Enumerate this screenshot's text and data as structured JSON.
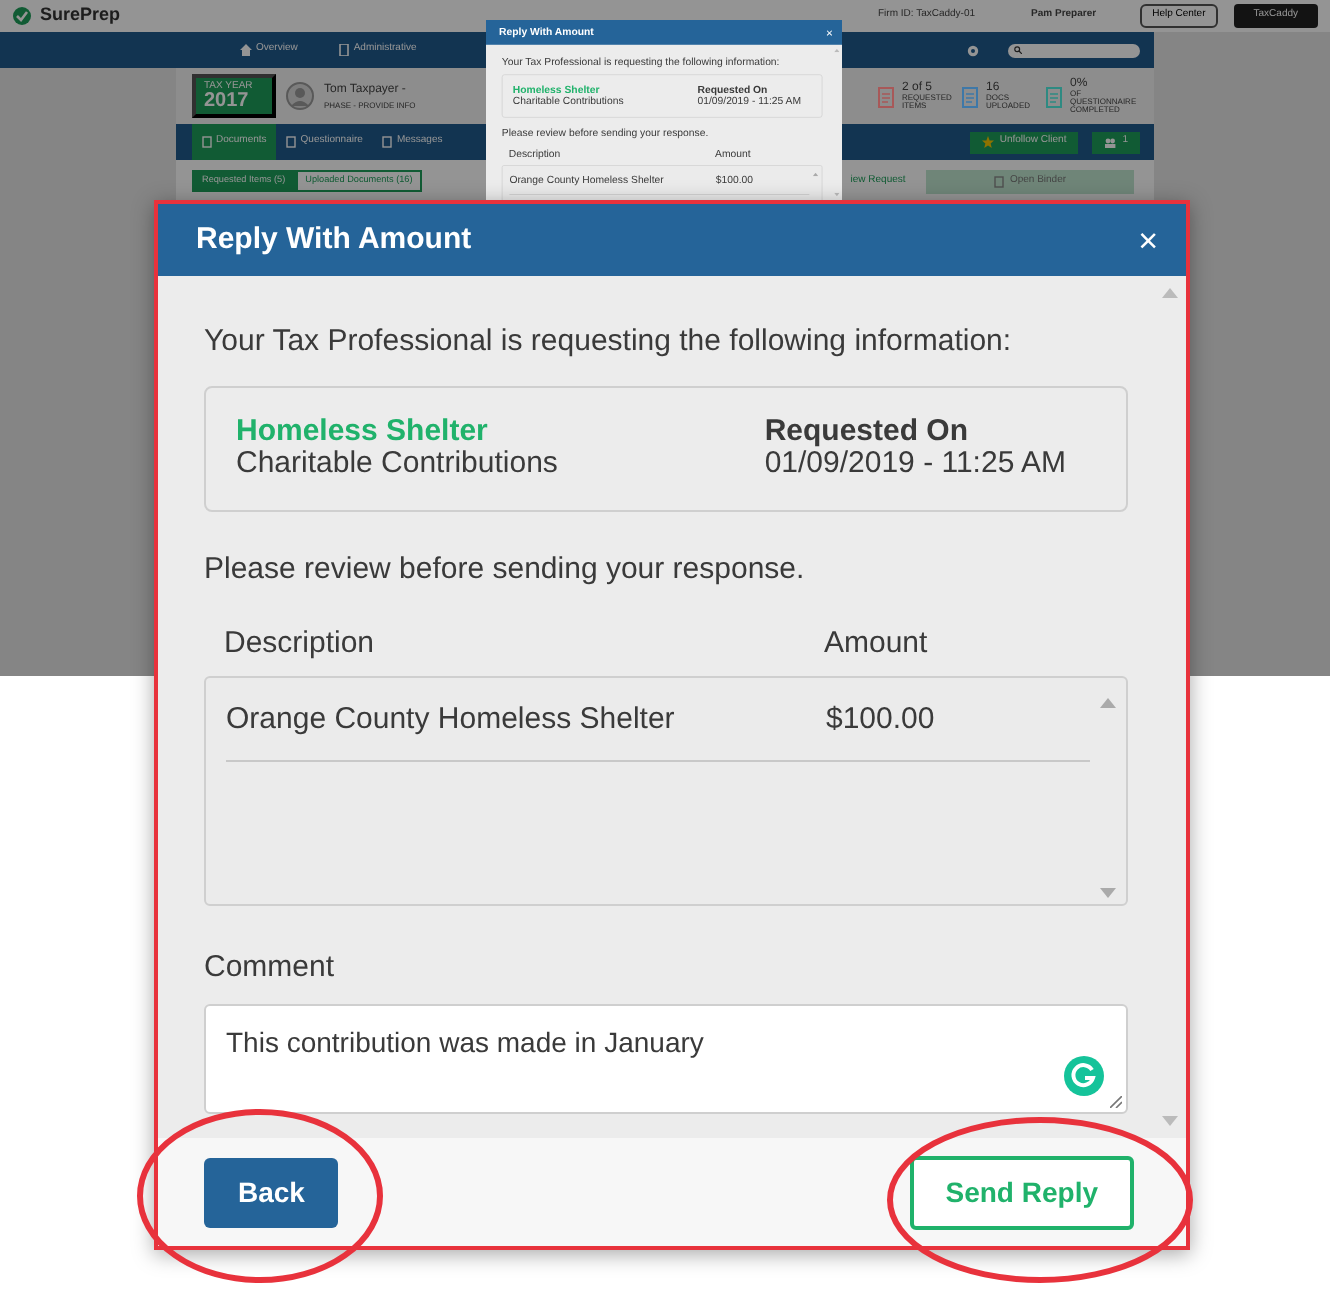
{
  "app": {
    "logo": "SurePrep",
    "firm_id_label": "Firm ID:",
    "firm_id": "TaxCaddy-01",
    "user": "Pam Preparer",
    "help": "Help Center",
    "account": "TaxCaddy",
    "nav": [
      "Overview",
      "Administrative"
    ],
    "client": {
      "tax_year_label": "TAX YEAR",
      "tax_year": "2017",
      "name": "Tom Taxpayer -",
      "phase": "PHASE - PROVIDE INFO"
    },
    "stats": [
      {
        "value": "2 of 5",
        "label": "REQUESTED ITEMS",
        "color": "#a85858"
      },
      {
        "value": "16",
        "label": "DOCS UPLOADED",
        "color": "#3e78a8"
      },
      {
        "value": "0%",
        "label": "OF QUESTIONNAIRE COMPLETED",
        "color": "#2e8a82"
      }
    ],
    "tabs": [
      {
        "label": "Documents",
        "selected": true
      },
      {
        "label": "Questionnaire",
        "selected": false
      },
      {
        "label": "Messages",
        "selected": false
      }
    ],
    "unfollow": "Unfollow Client",
    "followers": "1",
    "subtabs": [
      {
        "label": "Requested Items (5)",
        "selected": true
      },
      {
        "label": "Uploaded Documents (16)",
        "selected": false
      }
    ],
    "review_link": "iew Request",
    "binder": "Open Binder"
  },
  "preview_dialog": {
    "title": "Reply With Amount",
    "close": "×",
    "intro": "Your Tax Professional is requesting the following information:",
    "request": {
      "name": "Homeless Shelter",
      "category": "Charitable Contributions",
      "date_label": "Requested On",
      "date": "01/09/2019 - 11:25 AM"
    },
    "review": "Please review before sending your response.",
    "columns": [
      "Description",
      "Amount"
    ],
    "rows": [
      {
        "description": "Orange County Homeless Shelter",
        "amount": "$100.00"
      }
    ]
  },
  "dialog": {
    "title": "Reply With Amount",
    "close": "×",
    "intro": "Your Tax Professional is requesting the following information:",
    "request": {
      "name": "Homeless Shelter",
      "category": "Charitable Contributions",
      "date_label": "Requested On",
      "date": "01/09/2019 - 11:25 AM"
    },
    "review": "Please review before sending your response.",
    "columns": [
      "Description",
      "Amount"
    ],
    "rows": [
      {
        "description": "Orange County Homeless Shelter",
        "amount": "$100.00"
      }
    ],
    "comment_label": "Comment",
    "comment": "This contribution was made in January",
    "buttons": [
      {
        "label": "Back",
        "kind": "primary"
      },
      {
        "label": "Send Reply",
        "kind": "outline"
      }
    ]
  }
}
